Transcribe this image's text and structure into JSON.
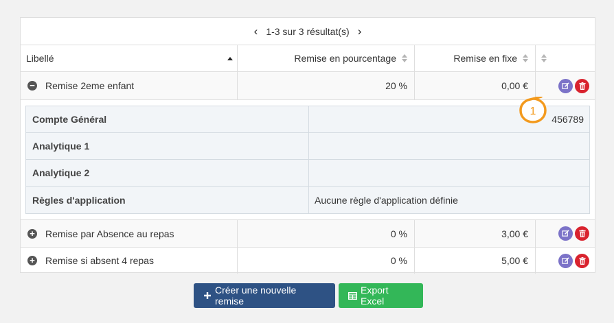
{
  "pager": {
    "text": "1-3 sur 3 résultat(s)"
  },
  "columns": {
    "label": "Libellé",
    "pct": "Remise en pourcentage",
    "fixed": "Remise en fixe"
  },
  "rows": [
    {
      "label": "Remise 2eme enfant",
      "pct": "20 %",
      "fixed": "0,00 €",
      "expanded": true
    },
    {
      "label": "Remise par Absence au repas",
      "pct": "0 %",
      "fixed": "3,00 €",
      "expanded": false
    },
    {
      "label": "Remise si absent 4 repas",
      "pct": "0 %",
      "fixed": "5,00 €",
      "expanded": false
    }
  ],
  "detail": {
    "items": [
      {
        "label": "Compte Général",
        "value": "456789"
      },
      {
        "label": "Analytique 1",
        "value": ""
      },
      {
        "label": "Analytique 2",
        "value": ""
      },
      {
        "label": "Règles d'application",
        "value": "Aucune règle d'application définie"
      }
    ]
  },
  "callout": {
    "number": "1"
  },
  "actions": {
    "create_label": "Créer une nouvelle remise",
    "export_label": "Export Excel"
  },
  "colors": {
    "edit": "#7c73c8",
    "delete": "#d9232e",
    "primary": "#2e5284",
    "success": "#33b758",
    "callout": "#f39a1e"
  },
  "icons": [
    "chevron-left-icon",
    "chevron-right-icon",
    "sort-icon",
    "minus-circle-icon",
    "plus-circle-icon",
    "edit-icon",
    "trash-icon",
    "plus-icon",
    "table-icon"
  ]
}
